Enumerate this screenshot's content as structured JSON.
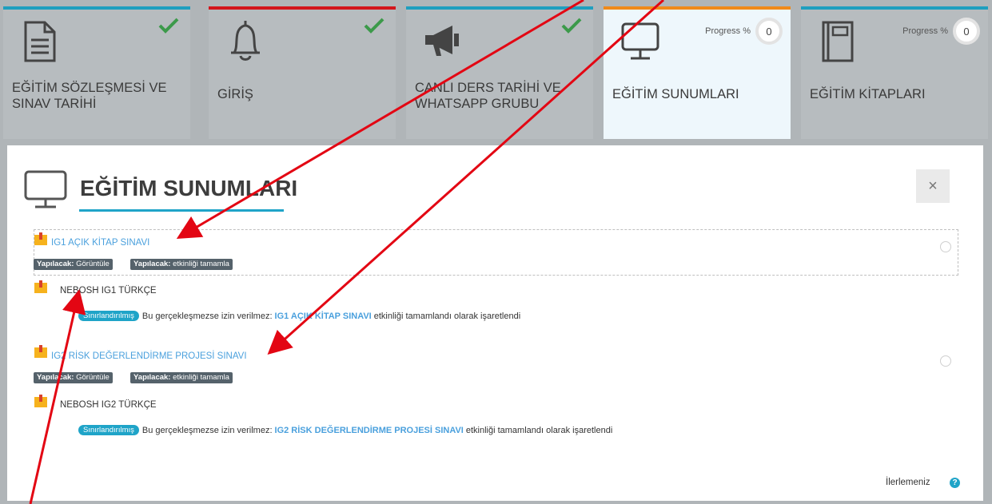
{
  "tiles": [
    {
      "title": "EĞİTİM SÖZLEŞMESİ VE SINAV TARİHİ",
      "bar_color": "#1f9fbf",
      "icon": "document-icon",
      "completed": true
    },
    {
      "title": "GİRİŞ",
      "bar_color": "#d3161c",
      "icon": "bell-icon",
      "completed": true
    },
    {
      "title": "CANLI DERS TARİHİ VE WHATSAPP GRUBU",
      "bar_color": "#1f9fbf",
      "icon": "megaphone-icon",
      "completed": true
    },
    {
      "title": "EĞİTİM SUNUMLARI",
      "bar_color": "#f08a1a",
      "icon": "monitor-icon",
      "progress_label": "Progress %",
      "progress_value": "0",
      "active": true
    },
    {
      "title": "EĞİTİM KİTAPLARI",
      "bar_color": "#1f9fbf",
      "icon": "book-icon",
      "progress_label": "Progress %",
      "progress_value": "0"
    }
  ],
  "section": {
    "title": "EĞİTİM SUNUMLARI",
    "close_label": "×",
    "icon": "monitor-icon"
  },
  "activities": [
    {
      "title": "IG1 AÇIK KİTAP SINAVI",
      "badges": [
        {
          "prefix": "Yapılacak:",
          "text": "Görüntüle"
        },
        {
          "prefix": "Yapılacak:",
          "text": "etkinliği tamamla"
        }
      ]
    },
    {
      "title": "NEBOSH IG1 TÜRKÇE",
      "restriction": {
        "pill": "Sınırlandırılmış",
        "prefix": "Bu gerçekleşmezse izin verilmez:",
        "link": "IG1 AÇIK KİTAP SINAVI",
        "suffix": "etkinliği tamamlandı olarak işaretlendi"
      }
    },
    {
      "title": "IG2 RİSK DEĞERLENDİRME PROJESİ SINAVI",
      "badges": [
        {
          "prefix": "Yapılacak:",
          "text": "Görüntüle"
        },
        {
          "prefix": "Yapılacak:",
          "text": "etkinliği tamamla"
        }
      ]
    },
    {
      "title": "NEBOSH IG2 TÜRKÇE",
      "restriction": {
        "pill": "Sınırlandırılmış",
        "prefix": "Bu gerçekleşmezse izin verilmez:",
        "link": "IG2 RİSK DEĞERLENDİRME PROJESİ SINAVI",
        "suffix": "etkinliği tamamlandı olarak işaretlendi"
      }
    }
  ],
  "footer": {
    "progress_text": "İlerlemeniz",
    "help_icon": "?"
  },
  "colors": {
    "accent": "#1fa4c8",
    "link": "#4aa0dd",
    "check": "#3c9a4a",
    "annotation_arrow": "#e30613"
  }
}
